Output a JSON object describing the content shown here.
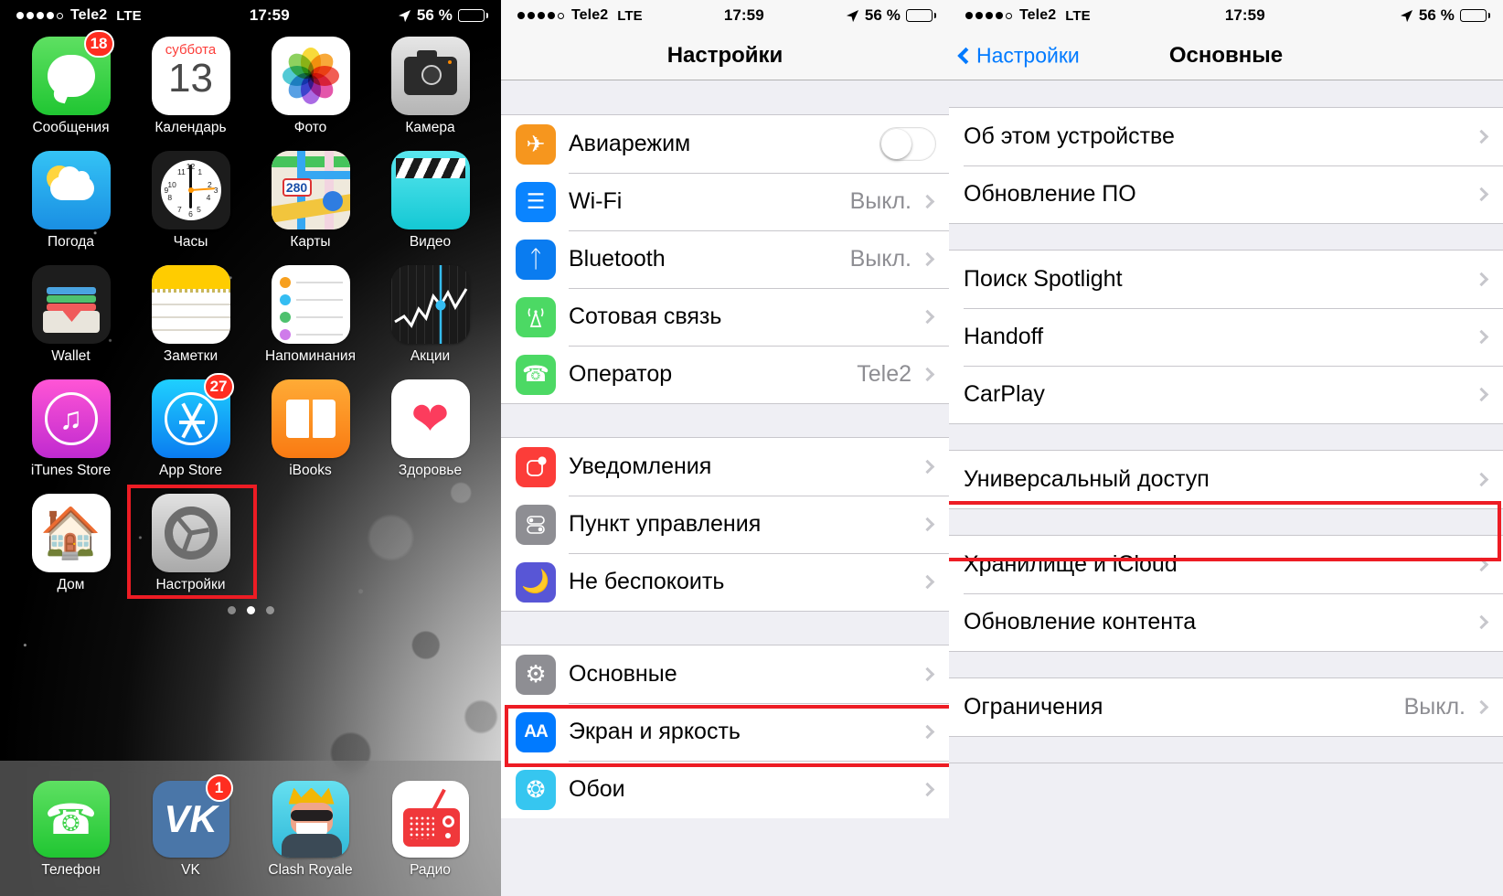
{
  "status_bar": {
    "carrier": "Tele2",
    "network": "LTE",
    "time": "17:59",
    "battery_percent": "56 %",
    "signal_dots_filled": 4,
    "signal_dots_total": 5,
    "location_icon": "location-arrow-icon"
  },
  "home_screen": {
    "apps": [
      {
        "label": "Сообщения",
        "icon": "messages-icon",
        "badge": "18"
      },
      {
        "label": "Календарь",
        "icon": "calendar-icon",
        "cal_weekday": "суббота",
        "cal_day": "13"
      },
      {
        "label": "Фото",
        "icon": "photos-icon"
      },
      {
        "label": "Камера",
        "icon": "camera-icon"
      },
      {
        "label": "Погода",
        "icon": "weather-icon"
      },
      {
        "label": "Часы",
        "icon": "clock-icon"
      },
      {
        "label": "Карты",
        "icon": "maps-icon",
        "maps_route": "280"
      },
      {
        "label": "Видео",
        "icon": "videos-icon"
      },
      {
        "label": "Wallet",
        "icon": "wallet-icon"
      },
      {
        "label": "Заметки",
        "icon": "notes-icon"
      },
      {
        "label": "Напоминания",
        "icon": "reminders-icon"
      },
      {
        "label": "Акции",
        "icon": "stocks-icon"
      },
      {
        "label": "iTunes Store",
        "icon": "itunes-store-icon"
      },
      {
        "label": "App Store",
        "icon": "app-store-icon",
        "badge": "27"
      },
      {
        "label": "iBooks",
        "icon": "ibooks-icon"
      },
      {
        "label": "Здоровье",
        "icon": "health-icon"
      },
      {
        "label": "Дом",
        "icon": "home-app-icon"
      },
      {
        "label": "Настройки",
        "icon": "settings-gear-icon",
        "highlighted": true
      }
    ],
    "dock": [
      {
        "label": "Телефон",
        "icon": "phone-icon"
      },
      {
        "label": "VK",
        "icon": "vk-icon",
        "badge": "1"
      },
      {
        "label": "Clash Royale",
        "icon": "clash-royale-icon"
      },
      {
        "label": "Радио",
        "icon": "radio-icon"
      }
    ],
    "page_dots": {
      "count": 3,
      "active_index": 1
    }
  },
  "settings_screen": {
    "title": "Настройки",
    "groups": [
      {
        "rows": [
          {
            "label": "Авиарежим",
            "icon": "airplane-icon",
            "control": "toggle",
            "toggle_on": false
          },
          {
            "label": "Wi-Fi",
            "icon": "wifi-icon",
            "value": "Выкл.",
            "chevron": true
          },
          {
            "label": "Bluetooth",
            "icon": "bluetooth-icon",
            "value": "Выкл.",
            "chevron": true
          },
          {
            "label": "Сотовая связь",
            "icon": "cellular-icon",
            "value": "",
            "chevron": true
          },
          {
            "label": "Оператор",
            "icon": "carrier-phone-icon",
            "value": "Tele2",
            "chevron": true
          }
        ]
      },
      {
        "rows": [
          {
            "label": "Уведомления",
            "icon": "notifications-icon",
            "value": "",
            "chevron": true
          },
          {
            "label": "Пункт управления",
            "icon": "control-center-icon",
            "value": "",
            "chevron": true
          },
          {
            "label": "Не беспокоить",
            "icon": "do-not-disturb-icon",
            "value": "",
            "chevron": true
          }
        ]
      },
      {
        "rows": [
          {
            "label": "Основные",
            "icon": "general-gear-icon",
            "value": "",
            "chevron": true,
            "highlighted": true
          },
          {
            "label": "Экран и яркость",
            "icon": "display-brightness-icon",
            "value": "",
            "chevron": true
          },
          {
            "label": "Обои",
            "icon": "wallpaper-icon",
            "value": "",
            "chevron": true
          }
        ]
      }
    ]
  },
  "general_screen": {
    "back_label": "Настройки",
    "title": "Основные",
    "groups": [
      {
        "rows": [
          {
            "label": "Об этом устройстве",
            "value": "",
            "chevron": true
          },
          {
            "label": "Обновление ПО",
            "value": "",
            "chevron": true
          }
        ]
      },
      {
        "rows": [
          {
            "label": "Поиск Spotlight",
            "value": "",
            "chevron": true
          },
          {
            "label": "Handoff",
            "value": "",
            "chevron": true
          },
          {
            "label": "CarPlay",
            "value": "",
            "chevron": true
          }
        ]
      },
      {
        "rows": [
          {
            "label": "Универсальный доступ",
            "value": "",
            "chevron": true,
            "highlighted": true
          }
        ]
      },
      {
        "rows": [
          {
            "label": "Хранилище и iCloud",
            "value": "",
            "chevron": true
          },
          {
            "label": "Обновление контента",
            "value": "",
            "chevron": true
          }
        ]
      },
      {
        "rows": [
          {
            "label": "Ограничения",
            "value": "Выкл.",
            "chevron": true
          }
        ]
      }
    ]
  },
  "colors": {
    "highlight_red": "#ed1c24",
    "ios_blue": "#007aff",
    "group_bg": "#efeff4",
    "separator": "#c8c7cc",
    "secondary_text": "#8e8e93",
    "badge_red": "#ff2d20"
  }
}
